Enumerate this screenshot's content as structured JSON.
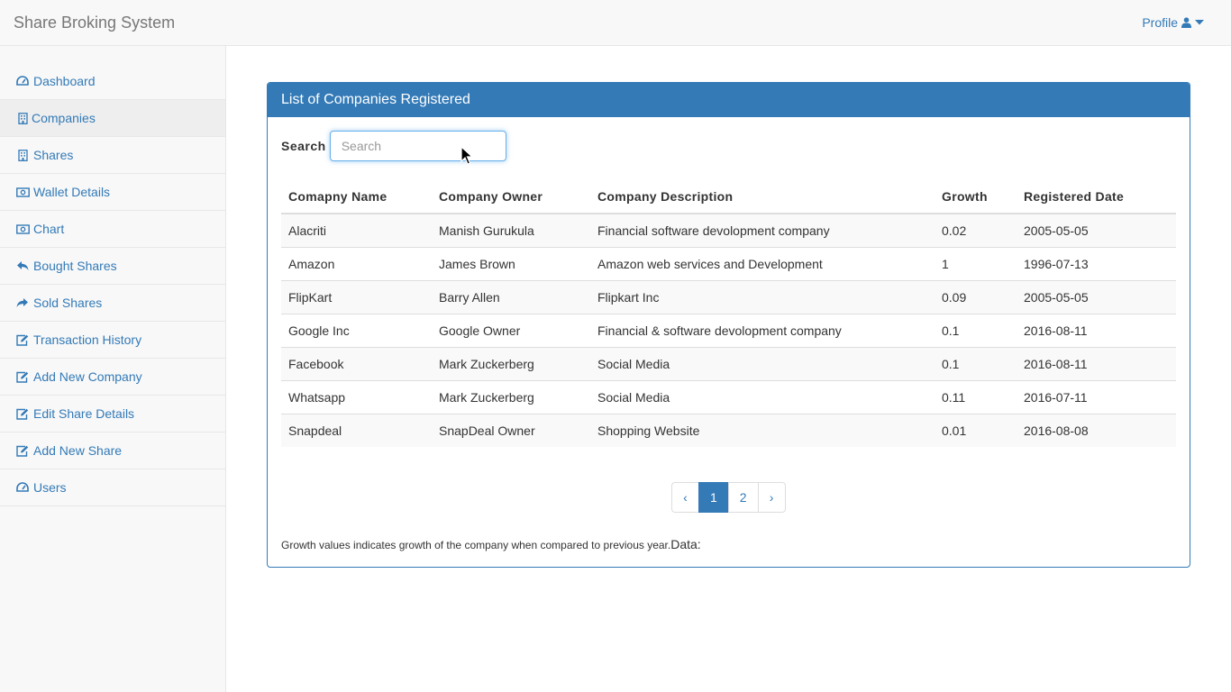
{
  "app": {
    "title": "Share Broking System",
    "profile_label": "Profile"
  },
  "sidebar": {
    "items": [
      {
        "label": "Dashboard",
        "icon": "dashboard-icon"
      },
      {
        "label": "Companies",
        "icon": "building-icon",
        "active": true
      },
      {
        "label": "Shares",
        "icon": "building-icon"
      },
      {
        "label": "Wallet Details",
        "icon": "money-icon"
      },
      {
        "label": "Chart",
        "icon": "money-icon"
      },
      {
        "label": "Bought Shares",
        "icon": "reply-icon"
      },
      {
        "label": "Sold Shares",
        "icon": "share-icon"
      },
      {
        "label": "Transaction History",
        "icon": "edit-icon"
      },
      {
        "label": "Add New Company",
        "icon": "edit-icon"
      },
      {
        "label": "Edit Share Details",
        "icon": "edit-icon"
      },
      {
        "label": "Add New Share",
        "icon": "edit-icon"
      },
      {
        "label": "Users",
        "icon": "dashboard-icon"
      }
    ]
  },
  "panel": {
    "title": "List of Companies Registered",
    "search": {
      "label": "Search",
      "placeholder": "Search",
      "value": ""
    },
    "table": {
      "headers": [
        "Comapny Name",
        "Company Owner",
        "Company Description",
        "Growth",
        "Registered Date"
      ],
      "rows": [
        [
          "Alacriti",
          "Manish Gurukula",
          "Financial software devolopment company",
          "0.02",
          "2005-05-05"
        ],
        [
          "Amazon",
          "James Brown",
          "Amazon web services and Development",
          "1",
          "1996-07-13"
        ],
        [
          "FlipKart",
          "Barry Allen",
          "Flipkart Inc",
          "0.09",
          "2005-05-05"
        ],
        [
          "Google Inc",
          "Google Owner",
          "Financial & software devolopment company",
          "0.1",
          "2016-08-11"
        ],
        [
          "Facebook",
          "Mark Zuckerberg",
          "Social Media",
          "0.1",
          "2016-08-11"
        ],
        [
          "Whatsapp",
          "Mark Zuckerberg",
          "Social Media",
          "0.11",
          "2016-07-11"
        ],
        [
          "Snapdeal",
          "SnapDeal Owner",
          "Shopping Website",
          "0.01",
          "2016-08-08"
        ]
      ]
    },
    "pagination": {
      "prev": "‹",
      "pages": [
        "1",
        "2"
      ],
      "active_page": "1",
      "next": "›"
    },
    "footer_note": "Growth values indicates growth of the company when compared to previous year.",
    "footer_data_label": "Data:"
  },
  "colors": {
    "primary": "#337ab7",
    "navbar_bg": "#f8f8f8",
    "border": "#e7e7e7"
  }
}
